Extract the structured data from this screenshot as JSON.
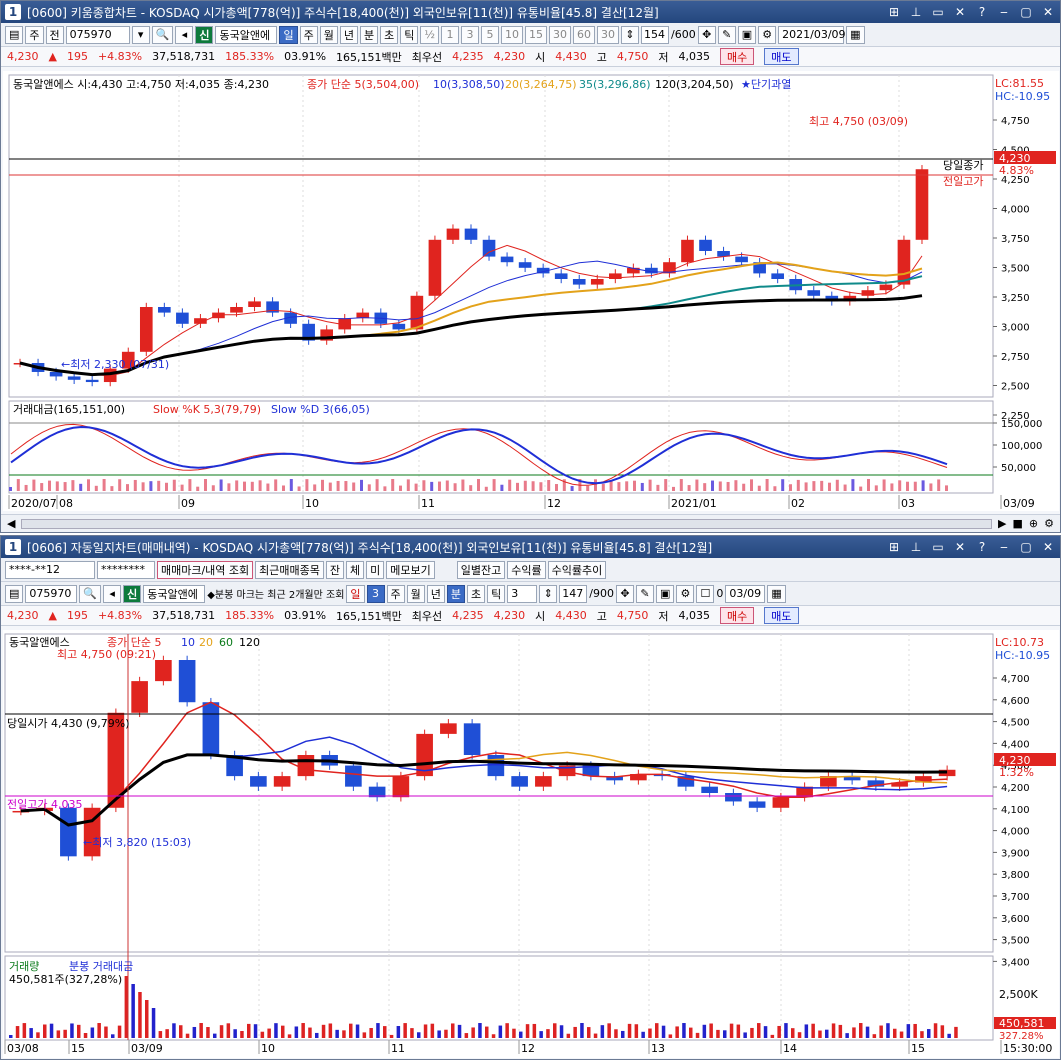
{
  "top": {
    "title_num": "1",
    "title": "[0600] 키움종합차트 - KOSDAQ 시가총액[778(억)] 주식수[18,400(천)] 외국인보유[11(천)] 유통비율[45.8] 결산[12월]",
    "toolbar": {
      "period": "주",
      "prev": "전",
      "code": "075970",
      "stock": "동국알앤에",
      "tag": "신",
      "units": [
        "일",
        "주",
        "월",
        "년",
        "분",
        "초",
        "틱"
      ],
      "mins": [
        "½",
        "1",
        "3",
        "5",
        "10",
        "15",
        "30",
        "60",
        "30"
      ],
      "count": "154",
      "count_total": "/600",
      "date": "2021/03/09"
    },
    "quote": {
      "price": "4,230",
      "change": "195",
      "rate": "+4.83%",
      "volume": "37,518,731",
      "vol_ratio": "185.33%",
      "turnover": "03.91%",
      "amount": "165,151백만",
      "best_label": "최우선",
      "best1": "4,235",
      "best2": "4,230",
      "open_label": "시",
      "open": "4,430",
      "high_label": "고",
      "high": "4,750",
      "low_label": "저",
      "low": "4,035",
      "buy": "매수",
      "sell": "매도"
    },
    "legend": {
      "stock": "동국알앤에스 시:4,430 고:4,750 저:4,035 종:4,230",
      "ma_label": "종가 단순 5(3,504,00)",
      "ma10": "10(3,308,50)",
      "ma20": "20(3,264,75)",
      "ma35": "35(3,296,86)",
      "ma120": "120(3,204,50)",
      "note": "★단기과열"
    },
    "lc": "LC:81.55",
    "hc": "HC:-10.95",
    "max_label": "최고 4,750 (03/09)",
    "min_label": "←최저 2,330 (07/31)",
    "close_tag": "당일종가",
    "prev_high_tag": "전일고가",
    "price_tag": "4,230",
    "price_pct": "4.83%",
    "yticks": [
      "4,750",
      "4,500",
      "4,250",
      "4,000",
      "3,750",
      "3,500",
      "3,250",
      "3,000",
      "2,750",
      "2,500",
      "2,250"
    ],
    "osc_legend_1": "거래대금(165,151,00)",
    "osc_legend_2": "Slow %K 5,3(79,79)",
    "osc_legend_3": "Slow %D 3(66,05)",
    "osc_ticks": [
      "150,000",
      "100,000",
      "50,000"
    ],
    "xlabels": [
      "2020/07",
      "08",
      "09",
      "10",
      "11",
      "12",
      "2021/01",
      "02",
      "03",
      "03/09"
    ]
  },
  "bottom": {
    "title_num": "1",
    "title": "[0606] 자동일지차트(매매내역) - KOSDAQ 시가총액[778(억)] 주식수[18,400(천)] 외국인보유[11(천)] 유통비율[45.8] 결산[12월]",
    "toolbar1": {
      "account": "****-**12",
      "password": "********",
      "btns": [
        "매매마크/내역 조회",
        "최근매매종목",
        "잔",
        "체",
        "미",
        "메모보기",
        "일별잔고",
        "수익률",
        "수익률추이"
      ]
    },
    "toolbar2": {
      "code": "075970",
      "tag": "신",
      "stock": "동국알앤에",
      "note": "◆분봉 마크는 최근 2개월만 조회",
      "units": [
        "일",
        "3",
        "주",
        "월",
        "년",
        "분",
        "초",
        "틱",
        "3"
      ],
      "count": "147",
      "count_total": "/900",
      "zero": "0",
      "date": "03/09"
    },
    "quote": {
      "price": "4,230",
      "change": "195",
      "rate": "+4.83%",
      "volume": "37,518,731",
      "vol_ratio": "185.33%",
      "turnover": "03.91%",
      "amount": "165,151백만",
      "best_label": "최우선",
      "best1": "4,235",
      "best2": "4,230",
      "open_label": "시",
      "open": "4,430",
      "high_label": "고",
      "high": "4,750",
      "low_label": "저",
      "low": "4,035",
      "buy": "매수",
      "sell": "매도"
    },
    "legend": {
      "stock": "동국알앤에스",
      "ma": "종가 단순 5",
      "ma10": "10",
      "ma20": "20",
      "ma60": "60",
      "ma120": "120"
    },
    "lc": "LC:10.73",
    "hc": "HC:-10.95",
    "max_label": "최고 4,750 (09:21)",
    "min_label": "←최저 3,820 (15:03)",
    "open_tag": "당일시가 4,430 (9,79%)",
    "prev_high_tag": "전일고가 4,035",
    "price_tag": "4,230",
    "price_pct": "1.32%",
    "yticks": [
      "4,700",
      "4,600",
      "4,500",
      "4,400",
      "4,300",
      "4,200",
      "4,100",
      "4,000",
      "3,900",
      "3,800",
      "3,700",
      "3,600",
      "3,500",
      "3,400"
    ],
    "vol_legend_1": "거래량",
    "vol_legend_2": "분봉 거래대금",
    "vol_legend_3": "450,581주(327,28%)",
    "vol_tick": "2,500K",
    "vol_tag": "450,581",
    "vol_pct": "327.28%",
    "xlabels": [
      "03/08",
      "15",
      "03/09",
      "10",
      "11",
      "12",
      "13",
      "14",
      "15",
      "15:30:00"
    ]
  },
  "chart_data": [
    {
      "type": "line",
      "title": "",
      "series": [
        {
          "name": "",
          "values": [
            2500,
            2420,
            2380,
            2350,
            2330,
            2450,
            2600,
            3000,
            2950,
            2850,
            2900,
            2950,
            3000,
            3050,
            2950,
            2850,
            2700,
            2800,
            2900,
            2950,
            2850,
            2800,
            3100,
            3600,
            3700,
            3600,
            3450,
            3400,
            3350,
            3300,
            3250,
            3200,
            3250,
            3300,
            3350,
            3300,
            3400,
            3600,
            3500,
            3450,
            3400,
            3300,
            3250,
            3150,
            3100,
            3050,
            3100,
            3150,
            3200,
            3600,
            4230
          ]
        }
      ],
      "ylim": [
        2250,
        4750
      ]
    },
    {
      "type": "line",
      "title": "",
      "series": [
        {
          "name": "",
          "values": [
            4035,
            4050,
            3820,
            4050,
            4500,
            4650,
            4750,
            4550,
            4300,
            4200,
            4150,
            4200,
            4300,
            4250,
            4150,
            4100,
            4200,
            4400,
            4450,
            4300,
            4200,
            4150,
            4200,
            4250,
            4200,
            4180,
            4210,
            4200,
            4150,
            4120,
            4080,
            4050,
            4100,
            4150,
            4200,
            4180,
            4150,
            4170,
            4200,
            4230
          ]
        }
      ],
      "ylim": [
        3400,
        4750
      ]
    }
  ]
}
